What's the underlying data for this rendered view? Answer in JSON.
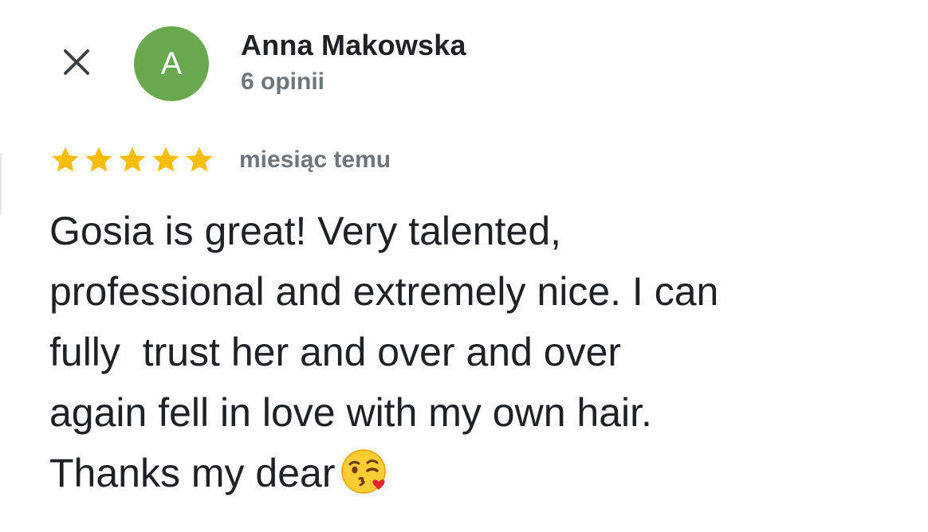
{
  "header": {
    "close_icon": "close-icon",
    "avatar": {
      "letter": "A",
      "color": "#6aa84f"
    },
    "reviewer_name": "Anna Makowska",
    "review_count": "6 opinii"
  },
  "review": {
    "rating": 5,
    "max_rating": 5,
    "star_color": "#fbbc04",
    "date": "miesiąc temu",
    "lines": [
      "Gosia is great! Very talented,",
      "professional and extremely nice. I can",
      "fully  trust her and over and over",
      "again fell in love with my own hair.",
      "Thanks my dear"
    ],
    "trailing_emoji": "face-blowing-a-kiss-emoji"
  }
}
